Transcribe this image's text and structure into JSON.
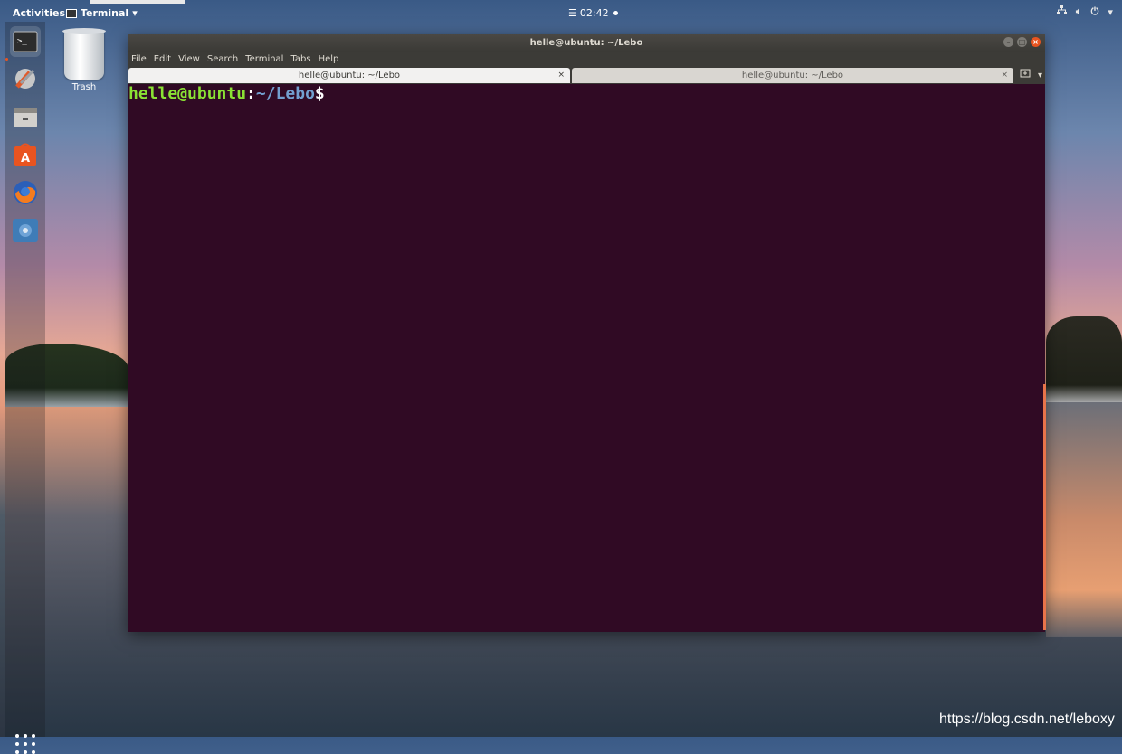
{
  "topbar": {
    "activities": "Activities",
    "app_menu": "Terminal",
    "clock": "02:42"
  },
  "desktop": {
    "trash_label": "Trash",
    "watermark": "https://blog.csdn.net/leboxy"
  },
  "dock": {
    "items": [
      "terminal-icon",
      "system-tools-icon",
      "files-icon",
      "software-store-icon",
      "firefox-icon",
      "settings-icon"
    ]
  },
  "window": {
    "title": "helle@ubuntu: ~/Lebo",
    "menu": [
      "File",
      "Edit",
      "View",
      "Search",
      "Terminal",
      "Tabs",
      "Help"
    ],
    "tabs": [
      {
        "label": "helle@ubuntu: ~/Lebo",
        "active": true
      },
      {
        "label": "helle@ubuntu: ~/Lebo",
        "active": false
      }
    ],
    "prompt": {
      "user_host": "helle@ubuntu",
      "colon": ":",
      "path": "~/Lebo",
      "symbol": "$"
    }
  },
  "colors": {
    "terminal_bg": "#300a24",
    "prompt_user": "#8ae234",
    "prompt_path": "#729fcf",
    "accent": "#e95420"
  }
}
